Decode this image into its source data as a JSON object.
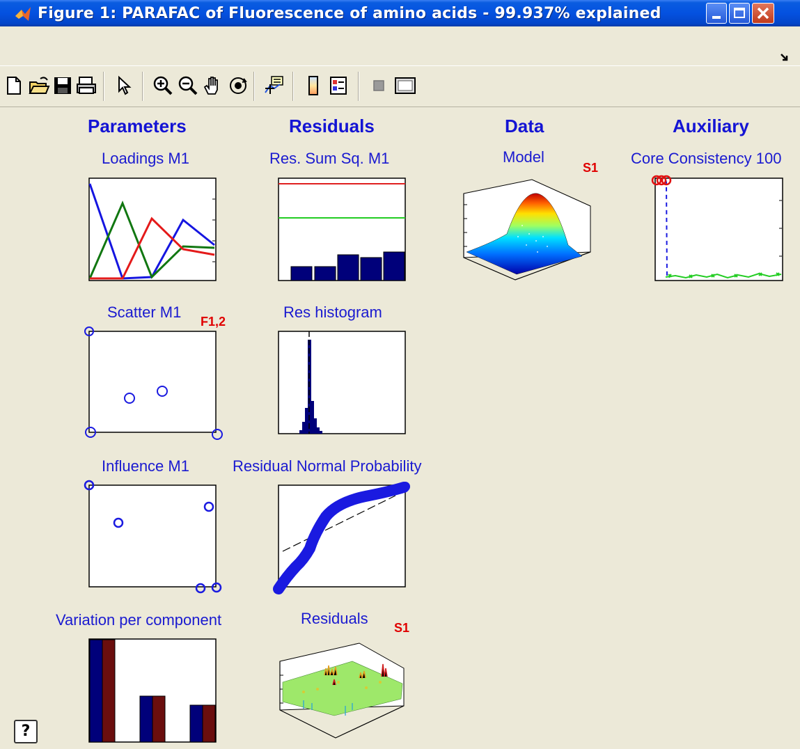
{
  "window": {
    "title": "Figure 1: PARAFAC of Fluorescence of amino acids - 99.937% explained",
    "controls": [
      "minimize",
      "maximize",
      "close"
    ]
  },
  "toolbar": {
    "icons": [
      "new-file-icon",
      "open-folder-icon",
      "save-icon",
      "print-icon",
      "pointer-icon",
      "zoom-in-icon",
      "zoom-out-icon",
      "pan-hand-icon",
      "rotate-3d-icon",
      "data-cursor-icon",
      "colorbar-icon",
      "legend-icon",
      "hide-plot-tools-icon",
      "show-plot-tools-icon"
    ]
  },
  "columns": {
    "parameters": "Parameters",
    "residuals": "Residuals",
    "data": "Data",
    "auxiliary": "Auxiliary"
  },
  "plots": {
    "loadings": {
      "title": "Loadings M1"
    },
    "ress": {
      "title": "Res. Sum Sq. M1"
    },
    "model": {
      "title": "Model",
      "tag": "S1"
    },
    "core": {
      "title": "Core Consistency 100"
    },
    "scatter": {
      "title": "Scatter M1",
      "tag": "F1,2"
    },
    "hist": {
      "title": "Res histogram"
    },
    "influence": {
      "title": "Influence M1"
    },
    "normprob": {
      "title": "Residual Normal Probability"
    },
    "variation": {
      "title": "Variation per component"
    },
    "residuals3d": {
      "title": "Residuals",
      "tag": "S1"
    }
  },
  "help": {
    "label": "?"
  },
  "colors": {
    "heading": "#1414d4",
    "titlebar": "#0451e0",
    "background": "#ece9d8",
    "tag": "#e00000"
  }
}
